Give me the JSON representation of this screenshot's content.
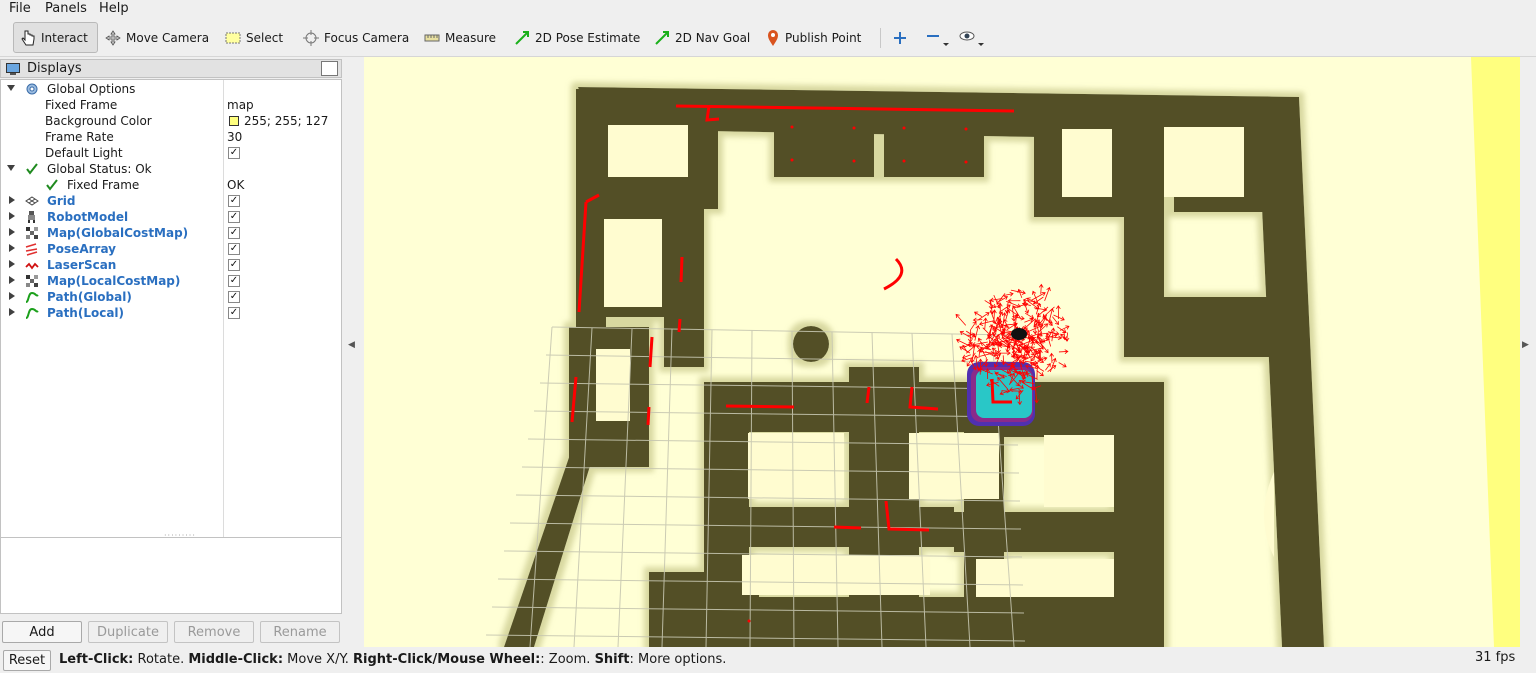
{
  "menu": {
    "file": "File",
    "panels": "Panels",
    "help": "Help"
  },
  "toolbar": {
    "interact": "Interact",
    "move_camera": "Move Camera",
    "select": "Select",
    "focus_camera": "Focus Camera",
    "measure": "Measure",
    "pose_estimate": "2D Pose Estimate",
    "nav_goal": "2D Nav Goal",
    "publish_point": "Publish Point"
  },
  "displays": {
    "title": "Displays",
    "global_options": "Global Options",
    "fixed_frame_label": "Fixed Frame",
    "fixed_frame_value": "map",
    "background_color_label": "Background Color",
    "background_color_value": "255; 255; 127",
    "frame_rate_label": "Frame Rate",
    "frame_rate_value": "30",
    "default_light_label": "Default Light",
    "global_status": "Global Status: Ok",
    "status_fixed_frame": "Fixed Frame",
    "status_fixed_frame_value": "OK",
    "items": [
      {
        "label": "Grid",
        "icon": "grid-icon",
        "checked": true
      },
      {
        "label": "RobotModel",
        "icon": "robot-icon",
        "checked": true
      },
      {
        "label": "Map(GlobalCostMap)",
        "icon": "map-icon",
        "checked": true
      },
      {
        "label": "PoseArray",
        "icon": "pose-array-icon",
        "checked": true
      },
      {
        "label": "LaserScan",
        "icon": "laser-scan-icon",
        "checked": true
      },
      {
        "label": "Map(LocalCostMap)",
        "icon": "map-icon",
        "checked": true
      },
      {
        "label": "Path(Global)",
        "icon": "path-icon",
        "checked": true
      },
      {
        "label": "Path(Local)",
        "icon": "path-icon",
        "checked": true
      }
    ]
  },
  "buttons": {
    "add": "Add",
    "duplicate": "Duplicate",
    "remove": "Remove",
    "rename": "Rename"
  },
  "status": {
    "reset": "Reset",
    "left_click": "Left-Click:",
    "left_action": " Rotate. ",
    "middle_click": "Middle-Click:",
    "middle_action": " Move X/Y. ",
    "right_click": "Right-Click/Mouse Wheel:",
    "right_action": ": Zoom. ",
    "shift": "Shift",
    "shift_action": ": More options.",
    "fps": "31 fps"
  },
  "colors": {
    "background": "#ffffd5",
    "obstacle": "#525026",
    "inflation": "#dcdca5",
    "laser": "#ff0000",
    "local_costmap": "#29c7c7"
  }
}
